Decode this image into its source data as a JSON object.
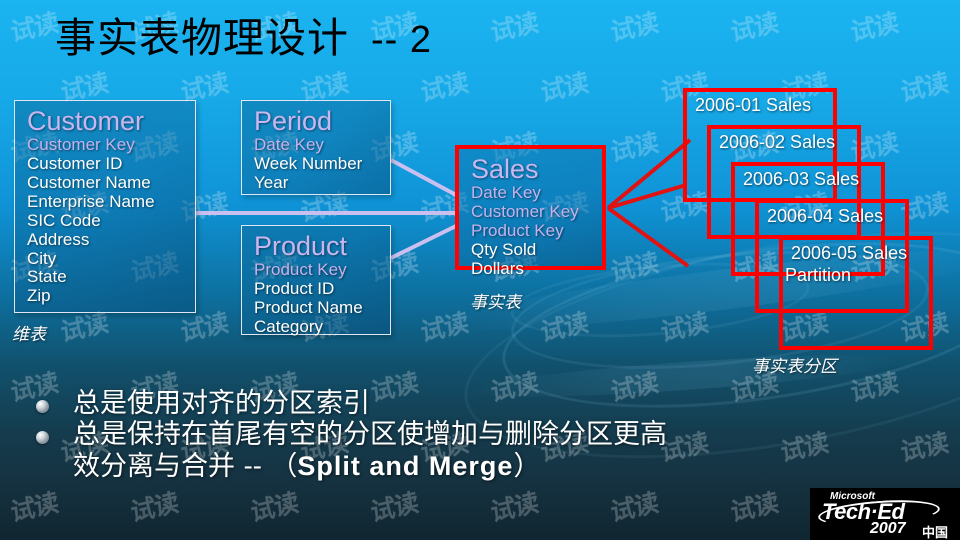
{
  "slide": {
    "title_cn": "事实表物理设计",
    "title_suffix": "-- 2"
  },
  "entities": {
    "customer": {
      "name": "Customer",
      "fields": [
        {
          "label": "Customer Key",
          "key": true
        },
        {
          "label": "Customer ID",
          "key": false
        },
        {
          "label": "Customer Name",
          "key": false
        },
        {
          "label": "Enterprise Name",
          "key": false
        },
        {
          "label": "SIC Code",
          "key": false
        },
        {
          "label": "Address",
          "key": false
        },
        {
          "label": "City",
          "key": false
        },
        {
          "label": "State",
          "key": false
        },
        {
          "label": "Zip",
          "key": false
        }
      ]
    },
    "period": {
      "name": "Period",
      "fields": [
        {
          "label": "Date Key",
          "key": true
        },
        {
          "label": "Week Number",
          "key": false
        },
        {
          "label": "Year",
          "key": false
        }
      ]
    },
    "product": {
      "name": "Product",
      "fields": [
        {
          "label": "Product Key",
          "key": true
        },
        {
          "label": "Product ID",
          "key": false
        },
        {
          "label": "Product Name",
          "key": false
        },
        {
          "label": "Category",
          "key": false
        }
      ]
    },
    "sales": {
      "name": "Sales",
      "fields": [
        {
          "label": "Date Key",
          "key": true
        },
        {
          "label": "Customer Key",
          "key": true
        },
        {
          "label": "Product Key",
          "key": true
        },
        {
          "label": "Qty Sold",
          "key": false
        },
        {
          "label": "Dollars",
          "key": false
        }
      ]
    }
  },
  "partitions": [
    {
      "label": "2006-01 Sales",
      "sublabel": ""
    },
    {
      "label": "2006-02 Sales",
      "sublabel": ""
    },
    {
      "label": "2006-03 Sales",
      "sublabel": ""
    },
    {
      "label": "2006-04 Sales",
      "sublabel": ""
    },
    {
      "label": "2006-05 Sales",
      "sublabel": "Partition"
    }
  ],
  "labels": {
    "dimension_tables": "维表",
    "fact_table": "事实表",
    "fact_partitions": "事实表分区"
  },
  "bullets": [
    {
      "text": "总是使用对齐的分区索引",
      "latin": ""
    },
    {
      "line1_cn": "总是保持在首尾有空的分区使增加与删除分区更高",
      "line2_pre": "效分离与合并 -- （",
      "line2_latin": "Split and Merge",
      "line2_post": "）"
    }
  ],
  "logo": {
    "microsoft": "Microsoft",
    "teched": "Tech·Ed",
    "year": "2007",
    "region": "中国"
  },
  "watermark": {
    "text": "试读"
  },
  "colors": {
    "accent_red": "#ff0000",
    "key_field": "#c4b2ef",
    "entity_name": "#c9b6f0",
    "connector": "#c9c0f0",
    "bg_top": "#1ab4f0",
    "bg_bottom": "#102631"
  }
}
